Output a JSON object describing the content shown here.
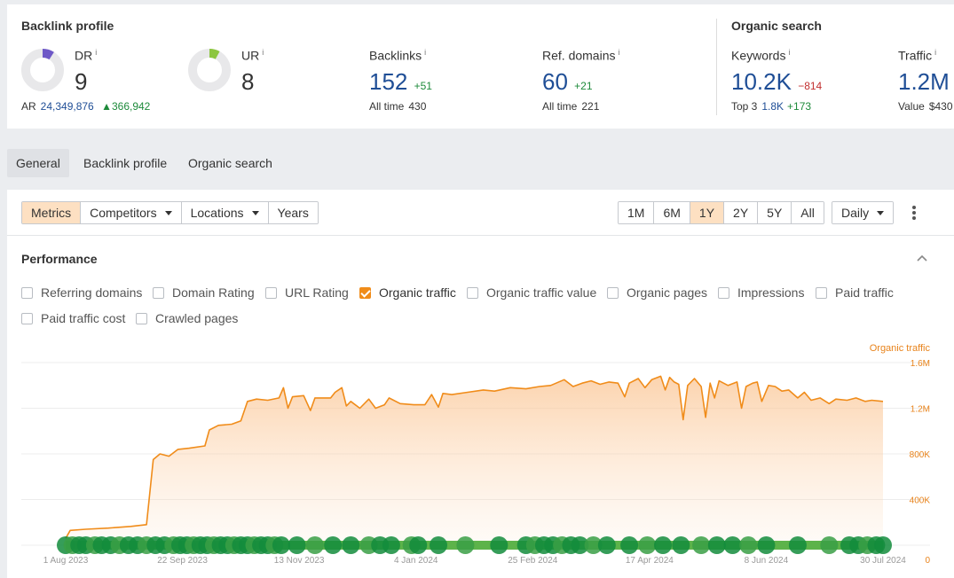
{
  "backlink_profile": {
    "title": "Backlink profile",
    "dr": {
      "label": "DR",
      "info": "i",
      "value": "9",
      "gauge_fraction": 0.09
    },
    "ur": {
      "label": "UR",
      "info": "i",
      "value": "8",
      "gauge_fraction": 0.08
    },
    "ar": {
      "label": "AR",
      "value": "24,349,876",
      "delta": "366,942"
    },
    "backlinks": {
      "label": "Backlinks",
      "info": "i",
      "value": "152",
      "delta": "+51",
      "alltime_label": "All time",
      "alltime_value": "430"
    },
    "ref_domains": {
      "label": "Ref. domains",
      "info": "i",
      "value": "60",
      "delta": "+21",
      "alltime_label": "All time",
      "alltime_value": "221"
    }
  },
  "organic_search": {
    "title": "Organic search",
    "keywords": {
      "label": "Keywords",
      "info": "i",
      "value": "10.2K",
      "delta": "−814",
      "top3_label": "Top 3",
      "top3_value": "1.8K",
      "top3_delta": "+173"
    },
    "traffic": {
      "label": "Traffic",
      "info": "i",
      "value": "1.2M",
      "value_label": "Value",
      "value_value": "$430"
    }
  },
  "tabs": [
    "General",
    "Backlink profile",
    "Organic search"
  ],
  "toolbar": {
    "metrics": "Metrics",
    "competitors": "Competitors",
    "locations": "Locations",
    "years": "Years",
    "ranges": [
      "1M",
      "6M",
      "1Y",
      "2Y",
      "5Y",
      "All"
    ],
    "active_range": "1Y",
    "granularity": "Daily"
  },
  "performance": {
    "title": "Performance",
    "checkboxes": [
      {
        "label": "Referring domains",
        "checked": false
      },
      {
        "label": "Domain Rating",
        "checked": false
      },
      {
        "label": "URL Rating",
        "checked": false
      },
      {
        "label": "Organic traffic",
        "checked": true
      },
      {
        "label": "Organic traffic value",
        "checked": false
      },
      {
        "label": "Organic pages",
        "checked": false
      },
      {
        "label": "Impressions",
        "checked": false
      },
      {
        "label": "Paid traffic",
        "checked": false
      },
      {
        "label": "Paid traffic cost",
        "checked": false
      },
      {
        "label": "Crawled pages",
        "checked": false
      }
    ]
  },
  "colors": {
    "accent": "#f08c1a",
    "brand_blue": "#1f4e96",
    "up": "#1d8a3a",
    "down": "#c22f2f",
    "dot_dark": "#0e8a3c",
    "dot_light": "#55b048"
  },
  "chart_data": {
    "type": "area",
    "series": [
      {
        "name": "Organic traffic"
      }
    ],
    "y_axis_title": "Organic traffic",
    "y_ticks": [
      "1.6M",
      "1.2M",
      "800K",
      "400K",
      "0"
    ],
    "ylim": [
      0,
      1600000
    ],
    "x_ticks": [
      "1 Aug 2023",
      "22 Sep 2023",
      "13 Nov 2023",
      "4 Jan 2024",
      "25 Feb 2024",
      "17 Apr 2024",
      "8 Jun 2024",
      "30 Jul 2024"
    ],
    "x_range": [
      "2023-08-01",
      "2024-07-30"
    ],
    "points": [
      [
        "2023-08-01",
        60000
      ],
      [
        "2023-08-03",
        130000
      ],
      [
        "2023-08-10",
        140000
      ],
      [
        "2023-08-20",
        150000
      ],
      [
        "2023-08-30",
        165000
      ],
      [
        "2023-09-06",
        180000
      ],
      [
        "2023-09-09",
        750000
      ],
      [
        "2023-09-12",
        800000
      ],
      [
        "2023-09-16",
        780000
      ],
      [
        "2023-09-20",
        840000
      ],
      [
        "2023-09-25",
        850000
      ],
      [
        "2023-10-02",
        870000
      ],
      [
        "2023-10-04",
        1010000
      ],
      [
        "2023-10-08",
        1050000
      ],
      [
        "2023-10-14",
        1060000
      ],
      [
        "2023-10-18",
        1090000
      ],
      [
        "2023-10-21",
        1260000
      ],
      [
        "2023-10-25",
        1280000
      ],
      [
        "2023-10-30",
        1270000
      ],
      [
        "2023-11-04",
        1290000
      ],
      [
        "2023-11-06",
        1380000
      ],
      [
        "2023-11-08",
        1200000
      ],
      [
        "2023-11-10",
        1300000
      ],
      [
        "2023-11-15",
        1310000
      ],
      [
        "2023-11-18",
        1180000
      ],
      [
        "2023-11-20",
        1290000
      ],
      [
        "2023-11-27",
        1290000
      ],
      [
        "2023-11-29",
        1340000
      ],
      [
        "2023-12-02",
        1380000
      ],
      [
        "2023-12-04",
        1220000
      ],
      [
        "2023-12-06",
        1260000
      ],
      [
        "2023-12-10",
        1200000
      ],
      [
        "2023-12-14",
        1280000
      ],
      [
        "2023-12-17",
        1200000
      ],
      [
        "2023-12-21",
        1230000
      ],
      [
        "2023-12-23",
        1290000
      ],
      [
        "2023-12-28",
        1240000
      ],
      [
        "2024-01-03",
        1230000
      ],
      [
        "2024-01-08",
        1230000
      ],
      [
        "2024-01-11",
        1320000
      ],
      [
        "2024-01-14",
        1210000
      ],
      [
        "2024-01-16",
        1330000
      ],
      [
        "2024-01-20",
        1320000
      ],
      [
        "2024-01-27",
        1340000
      ],
      [
        "2024-02-03",
        1360000
      ],
      [
        "2024-02-08",
        1350000
      ],
      [
        "2024-02-15",
        1380000
      ],
      [
        "2024-02-22",
        1370000
      ],
      [
        "2024-02-28",
        1390000
      ],
      [
        "2024-03-04",
        1400000
      ],
      [
        "2024-03-10",
        1450000
      ],
      [
        "2024-03-14",
        1390000
      ],
      [
        "2024-03-18",
        1420000
      ],
      [
        "2024-03-22",
        1440000
      ],
      [
        "2024-03-26",
        1410000
      ],
      [
        "2024-03-30",
        1430000
      ],
      [
        "2024-04-03",
        1420000
      ],
      [
        "2024-04-06",
        1300000
      ],
      [
        "2024-04-08",
        1420000
      ],
      [
        "2024-04-12",
        1460000
      ],
      [
        "2024-04-15",
        1380000
      ],
      [
        "2024-04-18",
        1450000
      ],
      [
        "2024-04-22",
        1480000
      ],
      [
        "2024-04-24",
        1360000
      ],
      [
        "2024-04-26",
        1470000
      ],
      [
        "2024-04-28",
        1430000
      ],
      [
        "2024-04-30",
        1410000
      ],
      [
        "2024-05-02",
        1100000
      ],
      [
        "2024-05-04",
        1400000
      ],
      [
        "2024-05-07",
        1460000
      ],
      [
        "2024-05-10",
        1390000
      ],
      [
        "2024-05-12",
        1120000
      ],
      [
        "2024-05-14",
        1420000
      ],
      [
        "2024-05-16",
        1290000
      ],
      [
        "2024-05-18",
        1440000
      ],
      [
        "2024-05-22",
        1400000
      ],
      [
        "2024-05-26",
        1430000
      ],
      [
        "2024-05-28",
        1200000
      ],
      [
        "2024-05-30",
        1390000
      ],
      [
        "2024-06-02",
        1420000
      ],
      [
        "2024-06-04",
        1430000
      ],
      [
        "2024-06-06",
        1260000
      ],
      [
        "2024-06-09",
        1400000
      ],
      [
        "2024-06-12",
        1390000
      ],
      [
        "2024-06-15",
        1350000
      ],
      [
        "2024-06-18",
        1360000
      ],
      [
        "2024-06-22",
        1290000
      ],
      [
        "2024-06-25",
        1340000
      ],
      [
        "2024-06-28",
        1270000
      ],
      [
        "2024-07-02",
        1290000
      ],
      [
        "2024-07-06",
        1240000
      ],
      [
        "2024-07-09",
        1280000
      ],
      [
        "2024-07-14",
        1270000
      ],
      [
        "2024-07-18",
        1290000
      ],
      [
        "2024-07-22",
        1260000
      ],
      [
        "2024-07-25",
        1270000
      ],
      [
        "2024-07-30",
        1260000
      ]
    ],
    "event_markers": [
      "2023-08-01",
      "2023-08-04",
      "2023-08-07",
      "2023-08-10",
      "2023-08-14",
      "2023-08-17",
      "2023-08-21",
      "2023-08-25",
      "2023-08-29",
      "2023-09-02",
      "2023-09-06",
      "2023-09-10",
      "2023-09-14",
      "2023-09-18",
      "2023-09-21",
      "2023-09-24",
      "2023-09-27",
      "2023-09-30",
      "2023-10-03",
      "2023-10-06",
      "2023-10-09",
      "2023-10-12",
      "2023-10-15",
      "2023-10-18",
      "2023-10-21",
      "2023-10-24",
      "2023-10-27",
      "2023-10-30",
      "2023-11-02",
      "2023-11-05",
      "2023-11-12",
      "2023-11-20",
      "2023-11-28",
      "2023-12-06",
      "2023-12-14",
      "2023-12-19",
      "2023-12-24",
      "2024-01-02",
      "2024-01-05",
      "2024-01-14",
      "2024-01-26",
      "2024-02-10",
      "2024-02-22",
      "2024-02-26",
      "2024-03-01",
      "2024-03-05",
      "2024-03-09",
      "2024-03-13",
      "2024-03-17",
      "2024-03-23",
      "2024-03-29",
      "2024-04-08",
      "2024-04-16",
      "2024-04-23",
      "2024-05-01",
      "2024-05-10",
      "2024-05-17",
      "2024-05-24",
      "2024-05-31",
      "2024-06-08",
      "2024-06-22",
      "2024-07-06",
      "2024-07-15",
      "2024-07-19",
      "2024-07-23",
      "2024-07-27",
      "2024-07-30"
    ]
  }
}
